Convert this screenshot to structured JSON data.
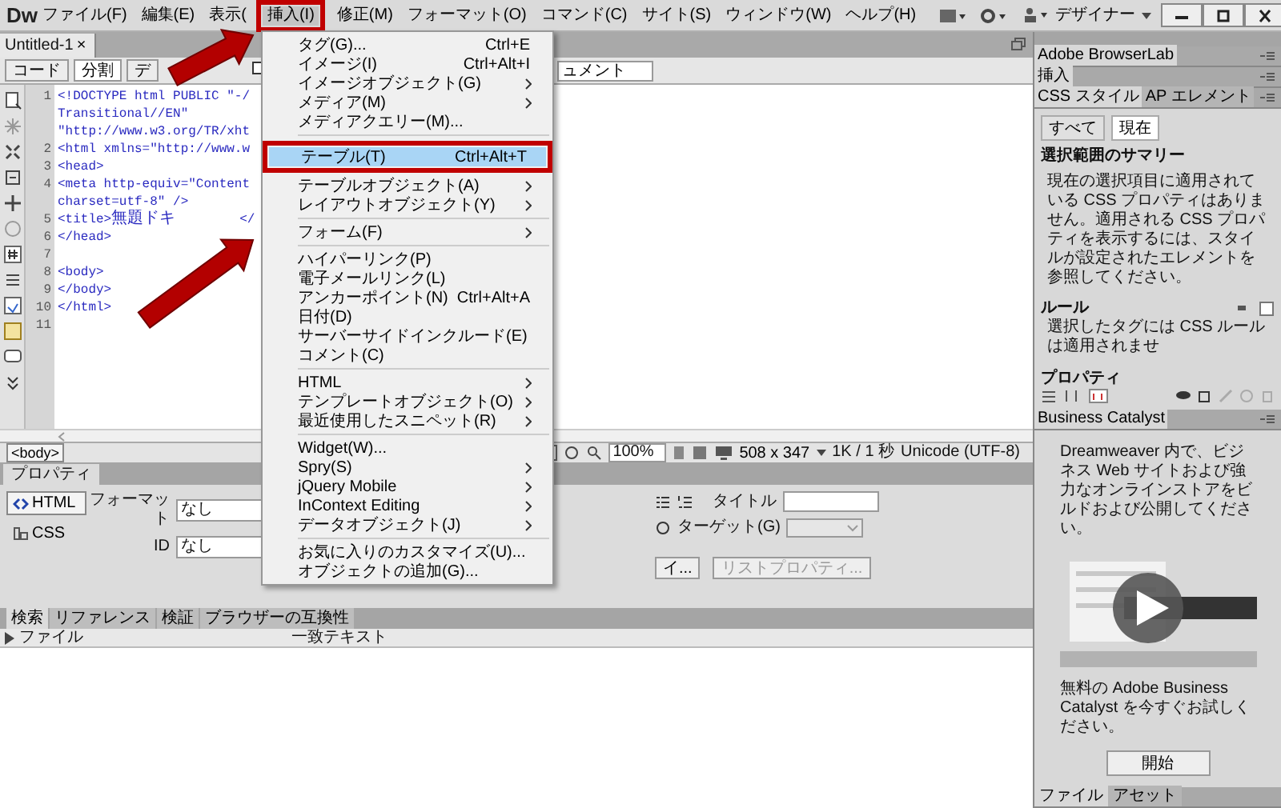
{
  "app": {
    "logo": "Dw",
    "workspace": "デザイナー"
  },
  "menubar": [
    {
      "label": "ファイル(F)",
      "selected": false,
      "highlighted": false
    },
    {
      "label": "編集(E)",
      "selected": false,
      "highlighted": false
    },
    {
      "label": "表示(",
      "selected": false,
      "highlighted": false
    },
    {
      "label": "挿入(I)",
      "selected": true,
      "highlighted": true
    },
    {
      "label": "修正(M)",
      "selected": false,
      "highlighted": false
    },
    {
      "label": "フォーマット(O)",
      "selected": false,
      "highlighted": false
    },
    {
      "label": "コマンド(C)",
      "selected": false,
      "highlighted": false
    },
    {
      "label": "サイト(S)",
      "selected": false,
      "highlighted": false
    },
    {
      "label": "ウィンドウ(W)",
      "selected": false,
      "highlighted": false
    },
    {
      "label": "ヘルプ(H)",
      "selected": false,
      "highlighted": false
    }
  ],
  "insert_menu": [
    {
      "kind": "item",
      "label": "タグ(G)...",
      "shortcut": "Ctrl+E",
      "submenu": false,
      "selected": false,
      "highlighted": false
    },
    {
      "kind": "item",
      "label": "イメージ(I)",
      "shortcut": "Ctrl+Alt+I",
      "submenu": false,
      "selected": false,
      "highlighted": false
    },
    {
      "kind": "item",
      "label": "イメージオブジェクト(G)",
      "submenu": true,
      "selected": false,
      "highlighted": false
    },
    {
      "kind": "item",
      "label": "メディア(M)",
      "submenu": true,
      "selected": false,
      "highlighted": false
    },
    {
      "kind": "item",
      "label": "メディアクエリー(M)...",
      "submenu": false,
      "selected": false,
      "highlighted": false
    },
    {
      "kind": "separator"
    },
    {
      "kind": "item",
      "label": "テーブル(T)",
      "shortcut": "Ctrl+Alt+T",
      "submenu": false,
      "selected": true,
      "highlighted": true
    },
    {
      "kind": "item",
      "label": "テーブルオブジェクト(A)",
      "submenu": true,
      "selected": false,
      "highlighted": false
    },
    {
      "kind": "item",
      "label": "レイアウトオブジェクト(Y)",
      "submenu": true,
      "selected": false,
      "highlighted": false
    },
    {
      "kind": "separator"
    },
    {
      "kind": "item",
      "label": "フォーム(F)",
      "submenu": true,
      "selected": false,
      "highlighted": false
    },
    {
      "kind": "separator"
    },
    {
      "kind": "item",
      "label": "ハイパーリンク(P)",
      "submenu": false,
      "selected": false,
      "highlighted": false
    },
    {
      "kind": "item",
      "label": "電子メールリンク(L)",
      "submenu": false,
      "selected": false,
      "highlighted": false
    },
    {
      "kind": "item",
      "label": "アンカーポイント(N)",
      "shortcut": "Ctrl+Alt+A",
      "submenu": false,
      "selected": false,
      "highlighted": false
    },
    {
      "kind": "item",
      "label": "日付(D)",
      "submenu": false,
      "selected": false,
      "highlighted": false
    },
    {
      "kind": "item",
      "label": "サーバーサイドインクルード(E)",
      "submenu": false,
      "selected": false,
      "highlighted": false
    },
    {
      "kind": "item",
      "label": "コメント(C)",
      "submenu": false,
      "selected": false,
      "highlighted": false
    },
    {
      "kind": "separator"
    },
    {
      "kind": "item",
      "label": "HTML",
      "submenu": true,
      "selected": false,
      "highlighted": false
    },
    {
      "kind": "item",
      "label": "テンプレートオブジェクト(O)",
      "submenu": true,
      "selected": false,
      "highlighted": false
    },
    {
      "kind": "item",
      "label": "最近使用したスニペット(R)",
      "submenu": true,
      "selected": false,
      "highlighted": false
    },
    {
      "kind": "separator"
    },
    {
      "kind": "item",
      "label": "Widget(W)...",
      "submenu": false,
      "selected": false,
      "highlighted": false
    },
    {
      "kind": "item",
      "label": "Spry(S)",
      "submenu": true,
      "selected": false,
      "highlighted": false
    },
    {
      "kind": "item",
      "label": "jQuery Mobile",
      "submenu": true,
      "selected": false,
      "highlighted": false
    },
    {
      "kind": "item",
      "label": "InContext Editing",
      "submenu": true,
      "selected": false,
      "highlighted": false
    },
    {
      "kind": "item",
      "label": "データオブジェクト(J)",
      "submenu": true,
      "selected": false,
      "highlighted": false
    },
    {
      "kind": "separator"
    },
    {
      "kind": "item",
      "label": "お気に入りのカスタマイズ(U)...",
      "submenu": false,
      "selected": false,
      "highlighted": false
    },
    {
      "kind": "item",
      "label": "オブジェクトの追加(G)...",
      "submenu": false,
      "selected": false,
      "highlighted": false
    }
  ],
  "document_tab": {
    "title": "Untitled-1",
    "close": "×"
  },
  "view_buttons": [
    {
      "label": "コード",
      "selected": false
    },
    {
      "label": "分割",
      "selected": true
    },
    {
      "label": "デ",
      "selected": false
    }
  ],
  "title_field": {
    "value": "ュメント"
  },
  "code_lines": [
    {
      "number": "1",
      "text": "<!DOCTYPE html PUBLIC \"-/"
    },
    {
      "text": "Transitional//EN\""
    },
    {
      "text": "\"http://www.w3.org/TR/xht"
    },
    {
      "number": "2",
      "text": "<html xmlns=\"http://www.w"
    },
    {
      "number": "3",
      "text": "<head>"
    },
    {
      "number": "4",
      "text": "<meta http-equiv=\"Content"
    },
    {
      "text": "charset=utf-8\" />"
    },
    {
      "number": "5",
      "text": "<title>無題ドキ",
      "tail": "</"
    },
    {
      "number": "6",
      "text": "</head>"
    },
    {
      "number": "7"
    },
    {
      "number": "8",
      "text": "<body>"
    },
    {
      "number": "9",
      "text": "</body>"
    },
    {
      "number": "10",
      "text": "</html>"
    },
    {
      "number": "11"
    }
  ],
  "status_bar": {
    "tag": "<body>",
    "zoom": "100%",
    "size": "508 x 347",
    "download": "1K / 1 秒",
    "encoding": "Unicode (UTF-8)"
  },
  "properties": {
    "title": "プロパティ",
    "modes": [
      {
        "label": "HTML",
        "selected": true
      },
      {
        "label": "CSS",
        "selected": false
      }
    ],
    "format_label": "フォーマット",
    "format_value": "なし",
    "id_label": "ID",
    "id_value": "なし",
    "title_label": "タイトル",
    "target_label": "ターゲット(G)",
    "buttons": [
      {
        "label": "イ...",
        "disabled": false
      },
      {
        "label": "リストプロパティ...",
        "disabled": true
      }
    ]
  },
  "results": {
    "tabs": [
      {
        "label": "検索",
        "selected": true
      },
      {
        "label": "リファレンス",
        "selected": false
      },
      {
        "label": "検証",
        "selected": false
      },
      {
        "label": "ブラウザーの互換性",
        "selected": false
      }
    ],
    "columns": [
      "ファイル",
      "一致テキスト"
    ]
  },
  "right_panel": {
    "browserlab": "Adobe BrowserLab",
    "insert": "挿入",
    "css_tabs": [
      {
        "label": "CSS スタイル",
        "selected": true
      },
      {
        "label": "AP エレメント",
        "selected": false
      }
    ],
    "view_tabs": [
      {
        "label": "すべて",
        "selected": false
      },
      {
        "label": "現在",
        "selected": true
      }
    ],
    "summary_title": "選択範囲のサマリー",
    "summary_text": "現在の選択項目に適用されている CSS プロパティはありません。適用される CSS プロパティを表示するには、スタイルが設定されたエレメントを参照してください。",
    "rules_title": "ルール",
    "rules_text": "選択したタグには CSS ルールは適用されませ",
    "properties_title": "プロパティ"
  },
  "business_catalyst": {
    "title": "Business Catalyst",
    "text": "Dreamweaver 内で、ビジネス Web サイトおよび強力なオンラインストアをビルドおよび公開してください。",
    "offer": "無料の Adobe Business Catalyst を今すぐお試しください。",
    "button": "開始"
  },
  "bottom_tabs": [
    {
      "label": "ファイル",
      "selected": true
    },
    {
      "label": "アセット",
      "selected": false
    }
  ]
}
